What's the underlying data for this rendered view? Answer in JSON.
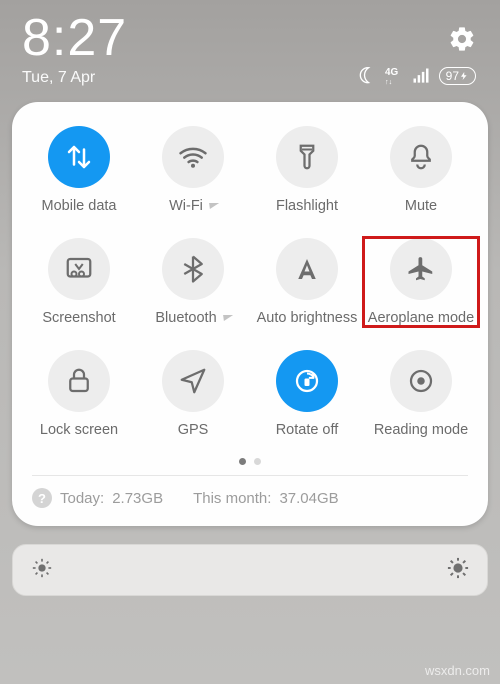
{
  "status": {
    "time": "8:27",
    "date": "Tue, 7 Apr",
    "network_type": "4G",
    "battery_text": "97"
  },
  "tiles": [
    {
      "key": "mobile-data",
      "label": "Mobile data",
      "active": true,
      "caret": false
    },
    {
      "key": "wifi",
      "label": "Wi-Fi",
      "active": false,
      "caret": true
    },
    {
      "key": "flashlight",
      "label": "Flashlight",
      "active": false,
      "caret": false
    },
    {
      "key": "mute",
      "label": "Mute",
      "active": false,
      "caret": false
    },
    {
      "key": "screenshot",
      "label": "Screenshot",
      "active": false,
      "caret": false
    },
    {
      "key": "bluetooth",
      "label": "Bluetooth",
      "active": false,
      "caret": true
    },
    {
      "key": "auto-brightness",
      "label": "Auto brightness",
      "active": false,
      "caret": false
    },
    {
      "key": "aeroplane-mode",
      "label": "Aeroplane mode",
      "active": false,
      "caret": false,
      "highlight": true
    },
    {
      "key": "lock-screen",
      "label": "Lock screen",
      "active": false,
      "caret": false
    },
    {
      "key": "gps",
      "label": "GPS",
      "active": false,
      "caret": false
    },
    {
      "key": "rotate-off",
      "label": "Rotate off",
      "active": true,
      "caret": false
    },
    {
      "key": "reading-mode",
      "label": "Reading mode",
      "active": false,
      "caret": false
    }
  ],
  "pager": {
    "pages": 2,
    "active": 0
  },
  "usage": {
    "today_label": "Today:",
    "today_value": "2.73GB",
    "month_label": "This month:",
    "month_value": "37.04GB"
  },
  "watermark": "wsxdn.com"
}
